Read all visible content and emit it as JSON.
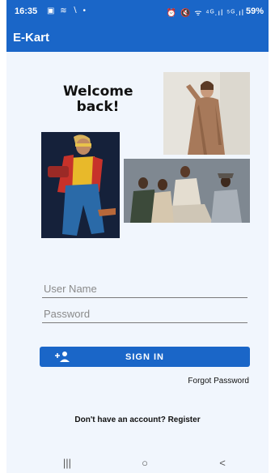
{
  "status_bar": {
    "time": "16:35",
    "left_icons": "▣ ≋ ∖ •",
    "right_icons": "⏰ 🔇 ᯤ ⁴ᴳ.ıl ⁵ᴳ.ıl",
    "battery": "59%"
  },
  "app_bar": {
    "title": "E-Kart"
  },
  "welcome_text": "Welcome back!",
  "form": {
    "username_placeholder": "User Name",
    "password_placeholder": "Password",
    "signin_label": "SIGN IN",
    "forgot_password": "Forgot Password",
    "register_prompt": "Don't have an account? Register"
  },
  "nav": {
    "recents": "|||",
    "home": "○",
    "back": "<"
  },
  "colors": {
    "primary": "#1a66c8",
    "background": "#f1f6fd"
  }
}
